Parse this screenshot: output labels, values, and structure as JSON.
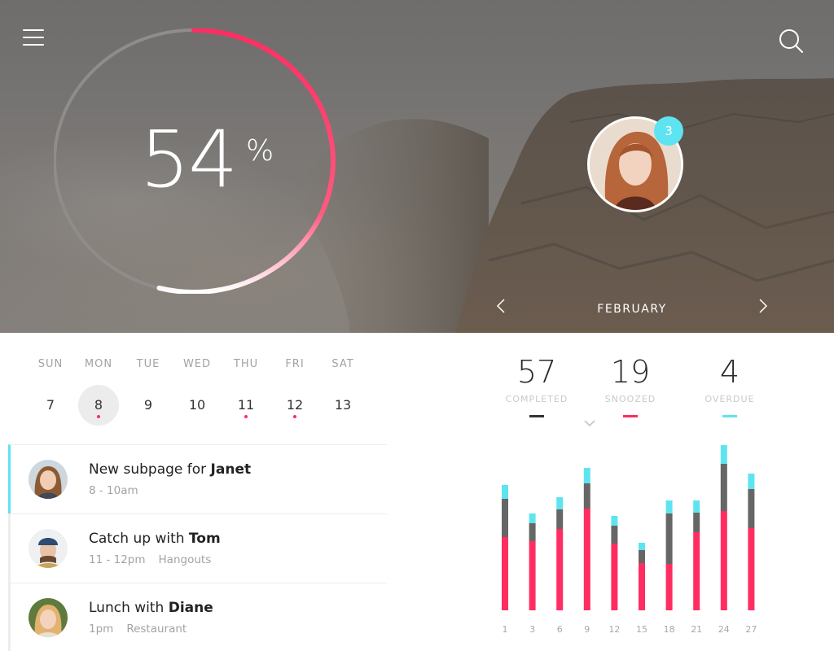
{
  "colors": {
    "accent_pink": "#ff2d61",
    "accent_cyan": "#5ee4f0",
    "gray_bar": "#666666"
  },
  "header": {
    "menu_icon": "hamburger-icon",
    "search_icon": "search-icon"
  },
  "progress": {
    "value": "54",
    "unit": "%",
    "fraction": 0.54
  },
  "profile": {
    "notifications": "3"
  },
  "month": {
    "label": "FEBRUARY",
    "prev_icon": "chevron-left-icon",
    "next_icon": "chevron-right-icon"
  },
  "calendar": {
    "days": [
      {
        "name": "SUN",
        "num": "7",
        "selected": false,
        "dot": false
      },
      {
        "name": "MON",
        "num": "8",
        "selected": true,
        "dot": true
      },
      {
        "name": "TUE",
        "num": "9",
        "selected": false,
        "dot": false
      },
      {
        "name": "WED",
        "num": "10",
        "selected": false,
        "dot": false
      },
      {
        "name": "THU",
        "num": "11",
        "selected": false,
        "dot": true
      },
      {
        "name": "FRI",
        "num": "12",
        "selected": false,
        "dot": true
      },
      {
        "name": "SAT",
        "num": "13",
        "selected": false,
        "dot": false
      }
    ]
  },
  "events": [
    {
      "title_pre": "New subpage for ",
      "person": "Janet",
      "time": "8 - 10am",
      "place": "",
      "active": true
    },
    {
      "title_pre": "Catch up with ",
      "person": "Tom",
      "time": "11 - 12pm",
      "place": "Hangouts",
      "active": false
    },
    {
      "title_pre": "Lunch with ",
      "person": "Diane",
      "time": "1pm",
      "place": "Restaurant",
      "active": false
    }
  ],
  "stats": [
    {
      "value": "57",
      "label": "COMPLETED",
      "color": "#333333"
    },
    {
      "value": "19",
      "label": "SNOOZED",
      "color": "#ff2d61"
    },
    {
      "value": "4",
      "label": "OVERDUE",
      "color": "#5ee4f0"
    }
  ],
  "chart_data": {
    "type": "bar",
    "stacked": true,
    "categories": [
      "1",
      "3",
      "6",
      "9",
      "12",
      "15",
      "18",
      "21",
      "24",
      "27"
    ],
    "series": [
      {
        "values": [
          90,
          85,
          100,
          125,
          82,
          58,
          57,
          96,
          122,
          101
        ],
        "color": "#ff2d61"
      },
      {
        "values": [
          47,
          22,
          24,
          31,
          22,
          16,
          62,
          24,
          58,
          48
        ],
        "color": "#666666"
      },
      {
        "values": [
          17,
          12,
          15,
          19,
          12,
          9,
          16,
          15,
          23,
          19
        ],
        "color": "#5ee4f0"
      }
    ],
    "ylim": [
      0,
      210
    ],
    "grid": false
  }
}
